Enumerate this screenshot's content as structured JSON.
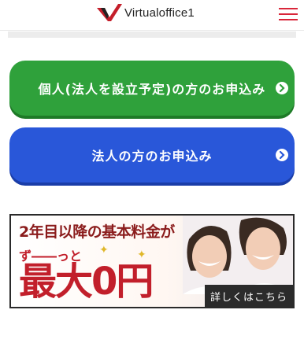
{
  "header": {
    "logo_text": "Virtualoffice1",
    "menu_icon": "hamburger-menu-icon",
    "logo_color": "#c41e2a"
  },
  "buttons": [
    {
      "label": "個人(法人を設立予定)の方のお申込み",
      "color": "#2fa13b",
      "icon": "arrow-right-circle-icon"
    },
    {
      "label": "法人の方のお申込み",
      "color": "#2957d9",
      "icon": "arrow-right-circle-icon"
    }
  ],
  "banner": {
    "line1": "2年目以降の基本料金が",
    "line2": "ず――っと",
    "line3": "最大0円",
    "more": "詳しくはこちら"
  },
  "colors": {
    "accent": "#d9263a",
    "banner_text": "#c21f2b"
  }
}
